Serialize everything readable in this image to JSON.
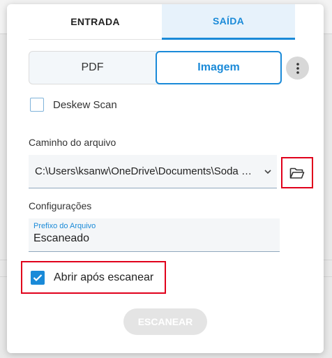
{
  "tabs": {
    "entrada": "ENTRADA",
    "saida": "SAÍDA",
    "active": "saida"
  },
  "output_type": {
    "pdf": "PDF",
    "imagem": "Imagem",
    "selected": "imagem"
  },
  "more_icon": "more-vertical-icon",
  "deskew": {
    "label": "Deskew Scan",
    "checked": false
  },
  "file_path": {
    "label": "Caminho do arquivo",
    "value": "C:\\Users\\ksanw\\OneDrive\\Documents\\Soda PDF",
    "folder_icon": "folder-open-icon"
  },
  "config": {
    "label": "Configurações",
    "prefix_label": "Prefixo do Arquivo",
    "prefix_value": "Escaneado"
  },
  "open_after": {
    "label": "Abrir após escanear",
    "checked": true
  },
  "scan_button": "ESCANEAR",
  "colors": {
    "accent": "#1a8ad8",
    "highlight": "#e0001b",
    "disabled": "#e4e4e4"
  }
}
